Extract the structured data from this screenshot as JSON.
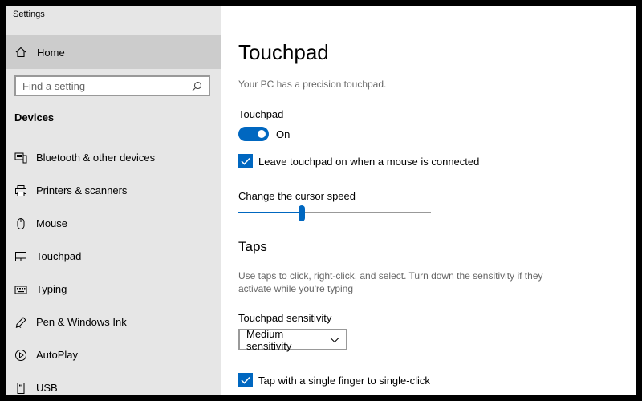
{
  "window": {
    "title": "Settings"
  },
  "sidebar": {
    "home_label": "Home",
    "search": {
      "placeholder": "Find a setting"
    },
    "section_title": "Devices",
    "items": [
      {
        "label": "Bluetooth & other devices",
        "icon": "bluetooth-devices-icon"
      },
      {
        "label": "Printers & scanners",
        "icon": "printer-icon"
      },
      {
        "label": "Mouse",
        "icon": "mouse-icon"
      },
      {
        "label": "Touchpad",
        "icon": "touchpad-icon"
      },
      {
        "label": "Typing",
        "icon": "keyboard-icon"
      },
      {
        "label": "Pen & Windows Ink",
        "icon": "pen-icon"
      },
      {
        "label": "AutoPlay",
        "icon": "autoplay-icon"
      },
      {
        "label": "USB",
        "icon": "usb-icon"
      }
    ]
  },
  "content": {
    "title": "Touchpad",
    "description": "Your PC has a precision touchpad.",
    "touchpad_label": "Touchpad",
    "toggle_state": "On",
    "leave_on_label": "Leave touchpad on when a mouse is connected",
    "leave_on_checked": true,
    "cursor_speed_label": "Change the cursor speed",
    "cursor_speed_value": 0.33,
    "taps_heading": "Taps",
    "taps_description": "Use taps to click, right-click, and select. Turn down the sensitivity if they activate while you're typing",
    "sensitivity_label": "Touchpad sensitivity",
    "sensitivity_value": "Medium sensitivity",
    "single_tap_label": "Tap with a single finger to single-click",
    "single_tap_checked": true
  },
  "colors": {
    "accent": "#0067c0",
    "sidebar_bg": "#e6e6e6",
    "selected_bg": "#cccccc",
    "secondary_text": "#666666"
  }
}
